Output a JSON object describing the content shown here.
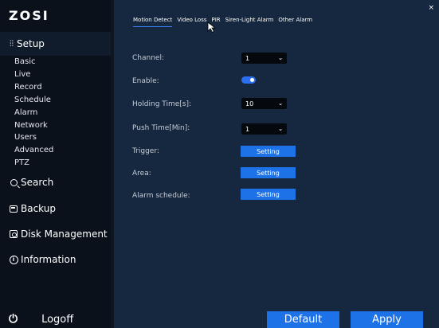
{
  "logo": "ZOSI",
  "sidebar": {
    "setup_label": "Setup",
    "setup_items": [
      {
        "label": "Basic"
      },
      {
        "label": "Live"
      },
      {
        "label": "Record"
      },
      {
        "label": "Schedule"
      },
      {
        "label": "Alarm"
      },
      {
        "label": "Network"
      },
      {
        "label": "Users"
      },
      {
        "label": "Advanced"
      },
      {
        "label": "PTZ"
      }
    ],
    "search_label": "Search",
    "backup_label": "Backup",
    "disk_label": "Disk Management",
    "info_label": "Information",
    "logoff_label": "Logoff"
  },
  "tabs": [
    {
      "label": "Motion Detect",
      "active": true
    },
    {
      "label": "Video Loss"
    },
    {
      "label": "PIR"
    },
    {
      "label": "Siren-Light Alarm"
    },
    {
      "label": "Other Alarm"
    }
  ],
  "form": {
    "channel_label": "Channel:",
    "channel_value": "1",
    "enable_label": "Enable:",
    "enable_on": true,
    "holding_label": "Holding Time[s]:",
    "holding_value": "10",
    "push_label": "Push Time[Min]:",
    "push_value": "1",
    "trigger_label": "Trigger:",
    "area_label": "Area:",
    "schedule_label": "Alarm schedule:",
    "setting_label": "Setting"
  },
  "buttons": {
    "default_label": "Default",
    "apply_label": "Apply",
    "close_glyph": "×"
  },
  "colors": {
    "accent": "#1d72e8",
    "sidebar_bg": "#0a111b",
    "main_bg": "#16283f"
  }
}
